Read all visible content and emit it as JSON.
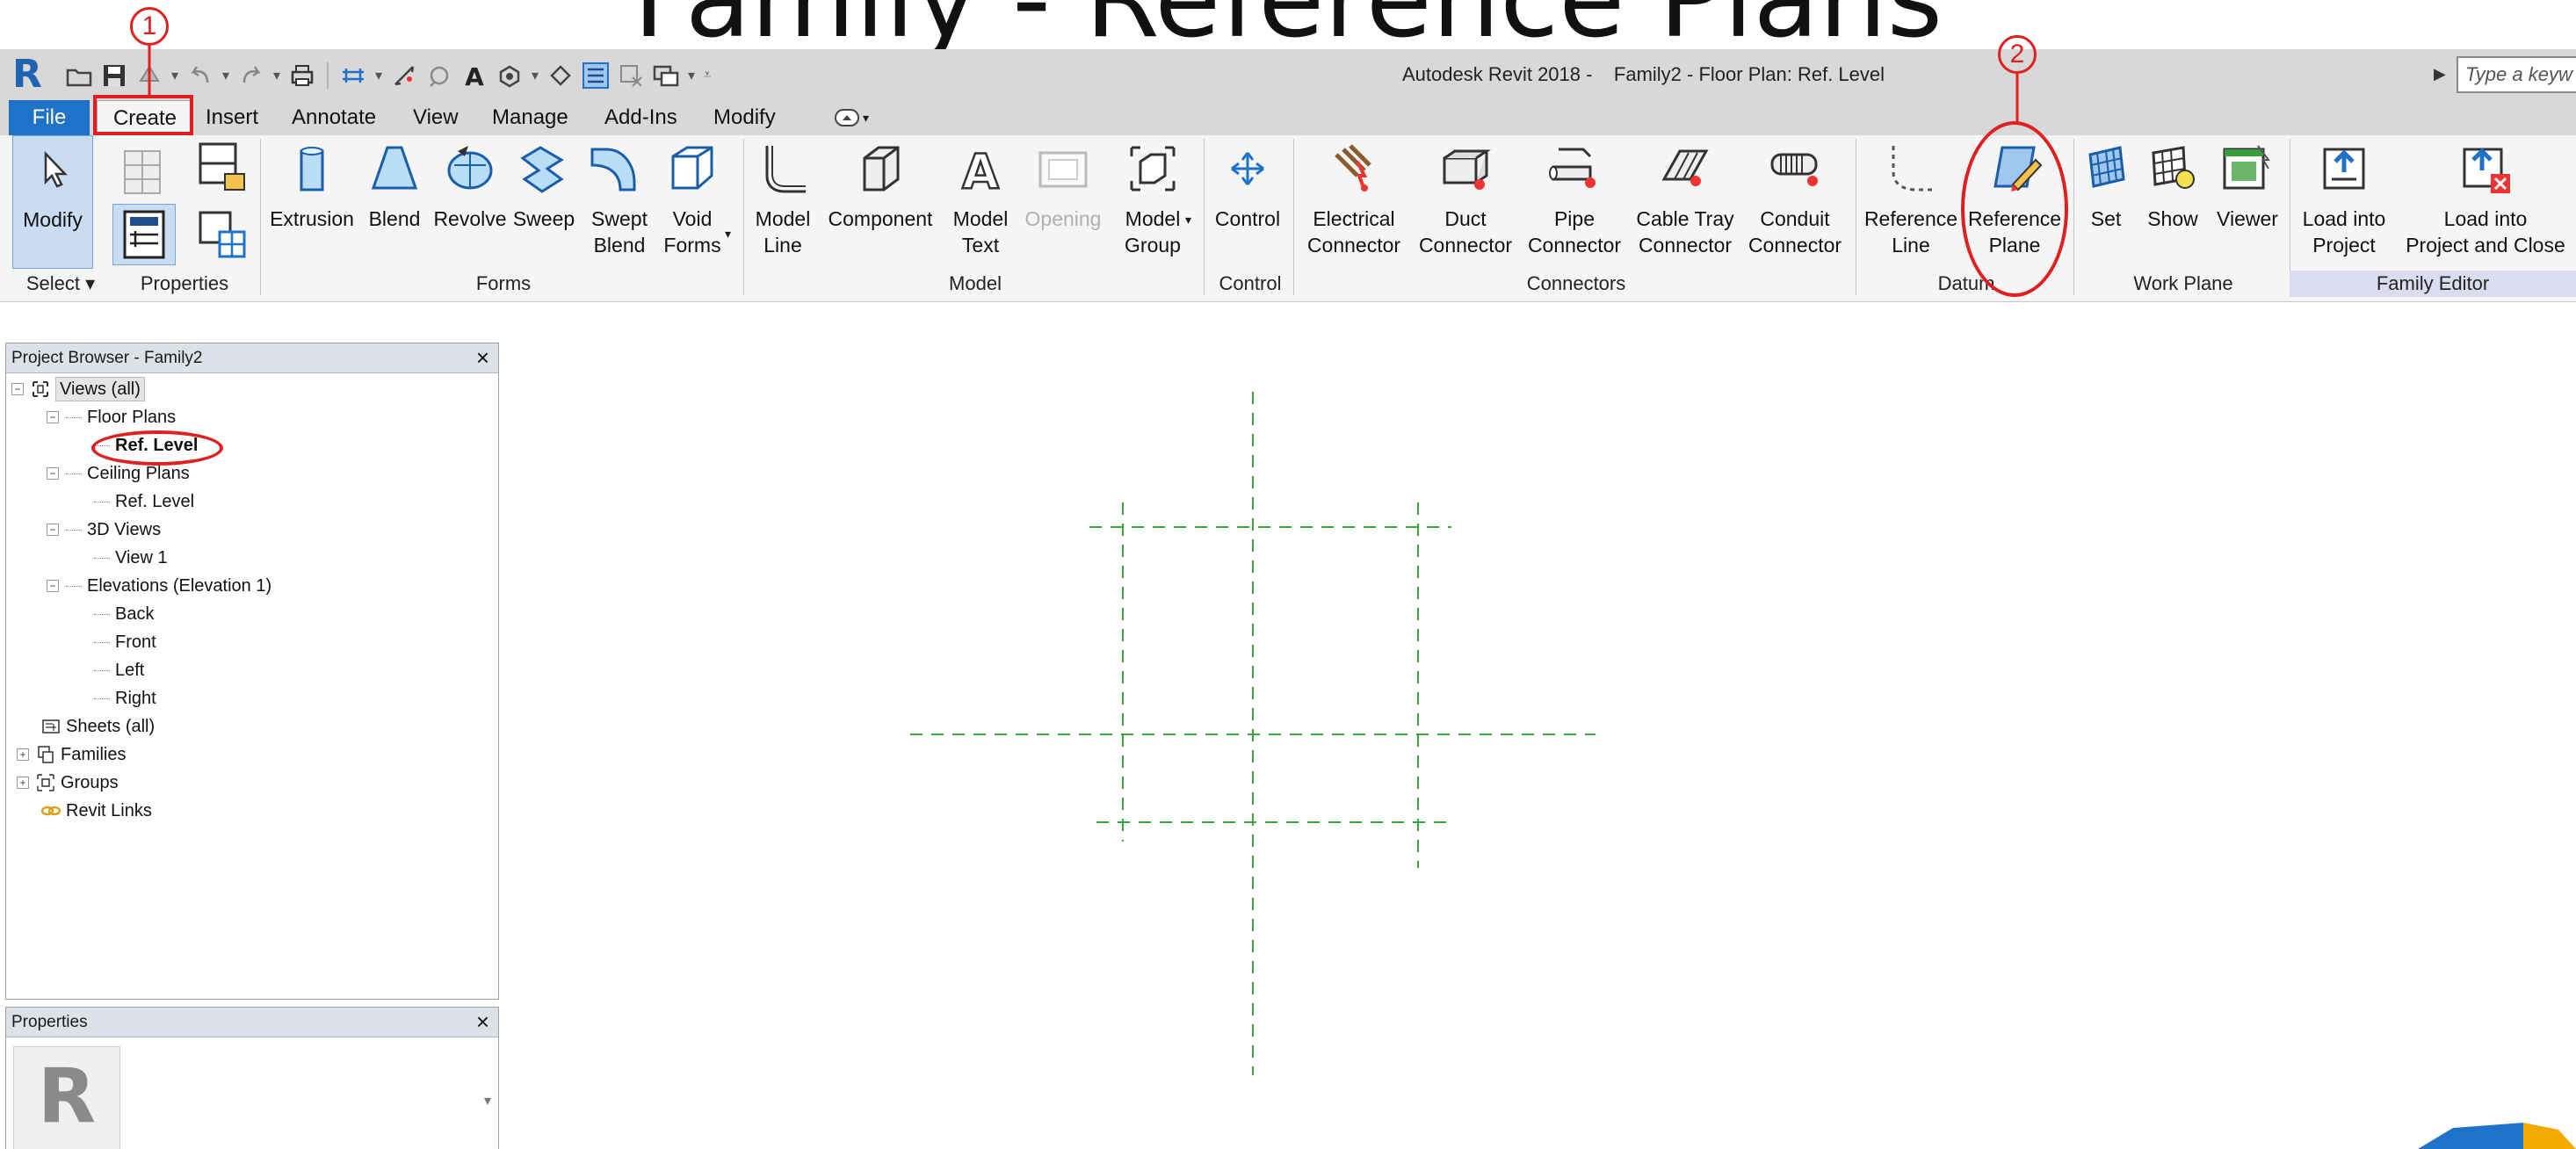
{
  "slide_title": "Family - Reference Plans",
  "app": {
    "window_title": "Autodesk Revit 2018 -    Family2 - Floor Plan: Ref. Level",
    "search_placeholder": "Type a keyw"
  },
  "tabs": [
    "File",
    "Create",
    "Insert",
    "Annotate",
    "View",
    "Manage",
    "Add-Ins",
    "Modify"
  ],
  "ribbon": {
    "select": {
      "modify": "Modify"
    },
    "forms": [
      {
        "label": "Extrusion",
        "icon": "extrusion-icon"
      },
      {
        "label": "Blend",
        "icon": "blend-icon"
      },
      {
        "label": "Revolve",
        "icon": "revolve-icon"
      },
      {
        "label": "Sweep",
        "icon": "sweep-icon"
      },
      {
        "label": "Swept\nBlend",
        "icon": "swept-blend-icon"
      },
      {
        "label": "Void\nForms",
        "icon": "void-forms-icon"
      }
    ],
    "model": [
      {
        "label": "Model\nLine",
        "icon": "model-line-icon"
      },
      {
        "label": "Component",
        "icon": "component-icon"
      },
      {
        "label": "Model\nText",
        "icon": "model-text-icon"
      },
      {
        "label": "Opening",
        "icon": "opening-icon",
        "disabled": true
      },
      {
        "label": "Model\nGroup",
        "icon": "model-group-icon"
      }
    ],
    "control": [
      {
        "label": "Control",
        "icon": "control-icon"
      }
    ],
    "connectors": [
      {
        "label": "Electrical\nConnector",
        "icon": "electrical-connector-icon"
      },
      {
        "label": "Duct\nConnector",
        "icon": "duct-connector-icon"
      },
      {
        "label": "Pipe\nConnector",
        "icon": "pipe-connector-icon"
      },
      {
        "label": "Cable Tray\nConnector",
        "icon": "cable-tray-connector-icon"
      },
      {
        "label": "Conduit\nConnector",
        "icon": "conduit-connector-icon"
      }
    ],
    "datum": [
      {
        "label": "Reference\nLine",
        "icon": "reference-line-icon"
      },
      {
        "label": "Reference\nPlane",
        "icon": "reference-plane-icon"
      }
    ],
    "work_plane": [
      {
        "label": "Set",
        "icon": "set-work-plane-icon"
      },
      {
        "label": "Show",
        "icon": "show-work-plane-icon"
      },
      {
        "label": "Viewer",
        "icon": "viewer-icon"
      }
    ],
    "family_editor": [
      {
        "label": "Load into\nProject",
        "icon": "load-into-project-icon"
      },
      {
        "label": "Load into\nProject and Close",
        "icon": "load-close-icon"
      }
    ],
    "panel_titles": {
      "select": "Select ▾",
      "properties": "Properties",
      "forms": "Forms",
      "model": "Model",
      "control": "Control",
      "connectors": "Connectors",
      "datum": "Datum",
      "work_plane": "Work Plane",
      "family_editor": "Family Editor"
    }
  },
  "project_browser": {
    "title": "Project Browser - Family2",
    "tree": [
      {
        "label": "Views (all)"
      },
      {
        "label": "Floor Plans"
      },
      {
        "label": "Ref. Level"
      },
      {
        "label": "Ceiling Plans"
      },
      {
        "label": "Ref. Level"
      },
      {
        "label": "3D Views"
      },
      {
        "label": "View 1"
      },
      {
        "label": "Elevations (Elevation 1)"
      },
      {
        "label": "Back"
      },
      {
        "label": "Front"
      },
      {
        "label": "Left"
      },
      {
        "label": "Right"
      },
      {
        "label": "Sheets (all)"
      },
      {
        "label": "Families"
      },
      {
        "label": "Groups"
      },
      {
        "label": "Revit Links"
      }
    ]
  },
  "properties_panel": {
    "title": "Properties"
  },
  "annotations": {
    "step1": "1",
    "step2": "2"
  },
  "colors": {
    "accent_red": "#e02020",
    "file_tab_blue": "#1e73c8",
    "ref_plane_green": "#3aa83a"
  }
}
